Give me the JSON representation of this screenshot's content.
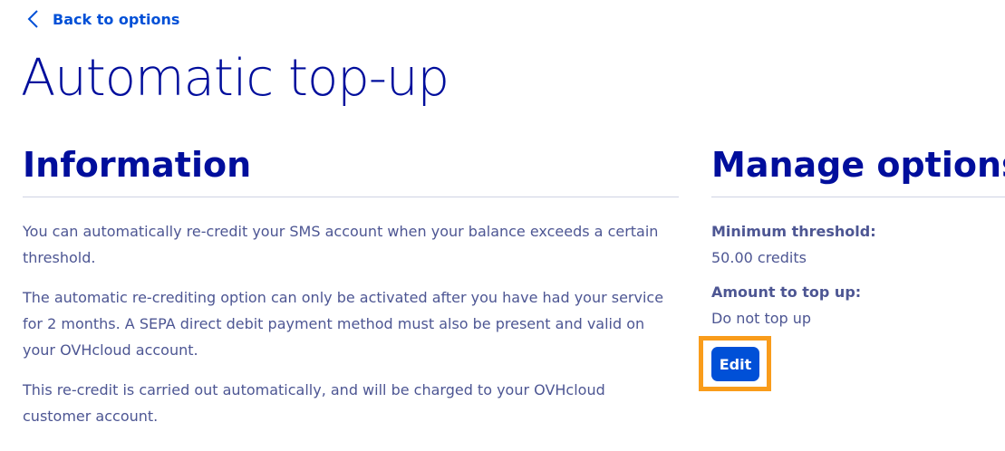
{
  "nav": {
    "back_label": "Back to options"
  },
  "page": {
    "title": "Automatic top-up"
  },
  "information": {
    "title": "Information",
    "paragraphs": [
      "You can automatically re-credit your SMS account when your balance exceeds a certain threshold.",
      "The automatic re-crediting option can only be activated after you have had your service for 2 months. A SEPA direct debit payment method must also be present and valid on your OVHcloud account.",
      "This re-credit is carried out automatically, and will be charged to your OVHcloud customer account."
    ]
  },
  "manage": {
    "title": "Manage options",
    "min_threshold_label": "Minimum threshold:",
    "min_threshold_value": "50.00 credits",
    "amount_label": "Amount to top up:",
    "amount_value": "Do not top up",
    "edit_label": "Edit"
  },
  "colors": {
    "link": "#0050d7",
    "heading": "#000e9c",
    "text": "#4d5693",
    "highlight": "#f99c1b",
    "button": "#0050d7"
  }
}
